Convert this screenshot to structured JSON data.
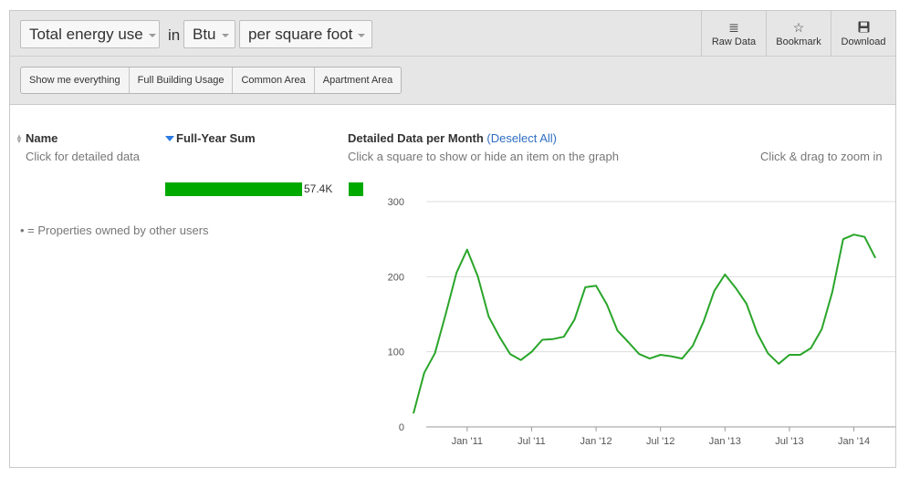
{
  "toolbar": {
    "metric": "Total energy use",
    "in_label": "in",
    "unit": "Btu",
    "normalization": "per square foot",
    "actions": [
      {
        "label": "Raw Data",
        "icon": "list-icon"
      },
      {
        "label": "Bookmark",
        "icon": "star-icon"
      },
      {
        "label": "Download",
        "icon": "floppy-disk-icon"
      }
    ],
    "filters": [
      "Show me everything",
      "Full Building Usage",
      "Common Area",
      "Apartment Area"
    ]
  },
  "columns": {
    "name": {
      "header": "Name",
      "sub": "Click for detailed data"
    },
    "sum": {
      "header": "Full-Year Sum",
      "value": "57.4K",
      "fraction": 1.0
    },
    "detail": {
      "header": "Detailed Data per Month",
      "deselect": "(Deselect All)",
      "sub": "Click a square to show or hide an item on the graph",
      "zoom_hint": "Click & drag to zoom in"
    }
  },
  "note": "• = Properties owned by other users",
  "colors": {
    "series": "#2aa52a",
    "bar": "#00a900",
    "link": "#2f6fc1",
    "grid": "#dddddd"
  },
  "chart_data": {
    "type": "line",
    "xlabel": "",
    "ylabel": "",
    "ylim": [
      0,
      300
    ],
    "yticks": [
      0,
      100,
      200,
      300
    ],
    "grid": true,
    "x_ticks": [
      {
        "label": "Jan '11",
        "index": 5
      },
      {
        "label": "Jul '11",
        "index": 11
      },
      {
        "label": "Jan '12",
        "index": 17
      },
      {
        "label": "Jul '12",
        "index": 23
      },
      {
        "label": "Jan '13",
        "index": 29
      },
      {
        "label": "Jul '13",
        "index": 35
      },
      {
        "label": "Jan '14",
        "index": 41
      }
    ],
    "x": [
      "Aug '10",
      "Sep '10",
      "Oct '10",
      "Nov '10",
      "Dec '10",
      "Jan '11",
      "Feb '11",
      "Mar '11",
      "Apr '11",
      "May '11",
      "Jun '11",
      "Jul '11",
      "Aug '11",
      "Sep '11",
      "Oct '11",
      "Nov '11",
      "Dec '11",
      "Jan '12",
      "Feb '12",
      "Mar '12",
      "Apr '12",
      "May '12",
      "Jun '12",
      "Jul '12",
      "Aug '12",
      "Sep '12",
      "Oct '12",
      "Nov '12",
      "Dec '12",
      "Jan '13",
      "Feb '13",
      "Mar '13",
      "Apr '13",
      "May '13",
      "Jun '13",
      "Jul '13",
      "Aug '13",
      "Sep '13",
      "Oct '13",
      "Nov '13",
      "Dec '13",
      "Jan '14",
      "Feb '14",
      "Mar '14"
    ],
    "series": [
      {
        "name": "",
        "values": [
          18,
          72,
          98,
          150,
          205,
          236,
          200,
          147,
          120,
          97,
          89,
          100,
          116,
          117,
          120,
          143,
          186,
          188,
          163,
          128,
          113,
          97,
          91,
          96,
          94,
          91,
          108,
          140,
          181,
          203,
          185,
          164,
          125,
          98,
          84,
          96,
          96,
          105,
          130,
          180,
          250,
          256,
          253,
          225
        ]
      }
    ]
  }
}
